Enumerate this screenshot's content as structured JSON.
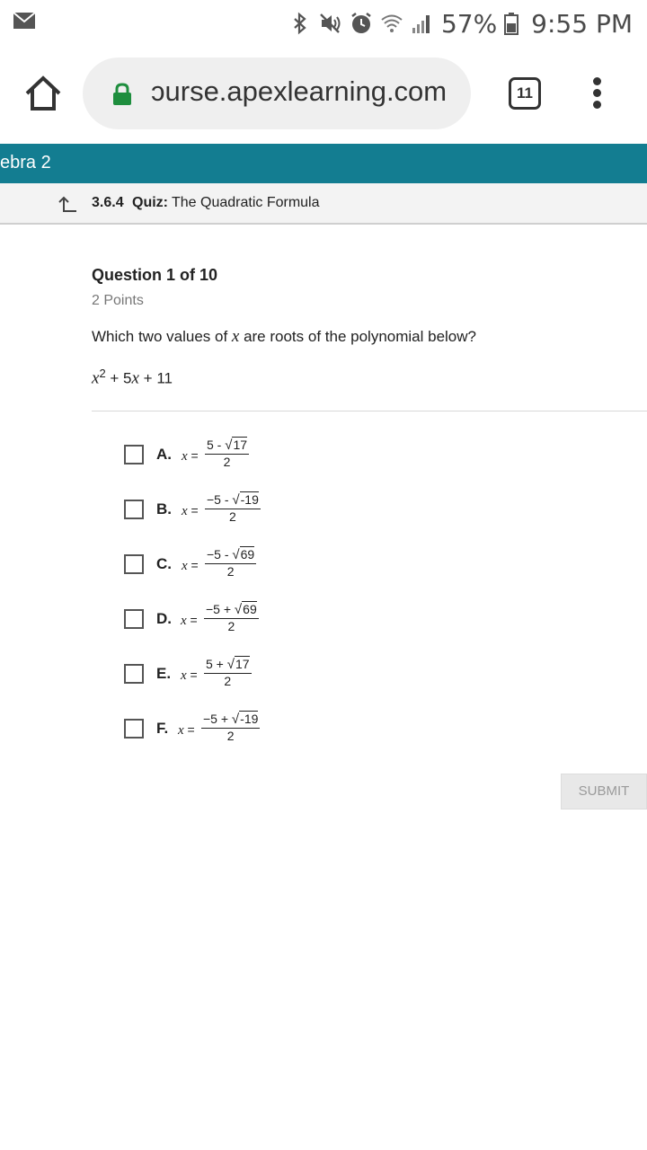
{
  "status_bar": {
    "battery_percent": "57%",
    "time": "9:55 PM",
    "icons": [
      "mail-icon",
      "bluetooth-icon",
      "mute-icon",
      "alarm-icon",
      "wifi-icon",
      "signal-icon",
      "battery-icon"
    ]
  },
  "browser": {
    "url": "ɔurse.apexlearning.com",
    "tab_count": "11"
  },
  "course": {
    "title": "ebra 2"
  },
  "quiz": {
    "number": "3.6.4",
    "label": "Quiz:",
    "name": "The Quadratic Formula"
  },
  "question": {
    "heading": "Question 1 of 10",
    "points": "2 Points",
    "prompt_before": "Which two values of ",
    "prompt_var": "x",
    "prompt_after": " are roots of the polynomial below?",
    "poly_x": "x",
    "poly_exp": "2",
    "poly_rest": " + 5",
    "poly_x2": "x",
    "poly_end": " + 11"
  },
  "options": [
    {
      "letter": "A.",
      "num_lead": "5 - ",
      "radicand": "17",
      "den": "2"
    },
    {
      "letter": "B.",
      "num_lead": "−5 - ",
      "radicand": "-19",
      "den": "2"
    },
    {
      "letter": "C.",
      "num_lead": "−5 - ",
      "radicand": "69",
      "den": "2"
    },
    {
      "letter": "D.",
      "num_lead": "−5 + ",
      "radicand": "69",
      "den": "2"
    },
    {
      "letter": "E.",
      "num_lead": "5 + ",
      "radicand": "17",
      "den": "2"
    },
    {
      "letter": "F.",
      "num_lead": "−5 + ",
      "radicand": "-19",
      "den": "2"
    }
  ],
  "option_x": "x",
  "option_eq": " =",
  "option_radical": "√",
  "submit_label": "SUBMIT",
  "colors": {
    "header_teal": "#137d91",
    "lock_green": "#1e8e3e",
    "submit_bg": "#e8e8e8"
  }
}
